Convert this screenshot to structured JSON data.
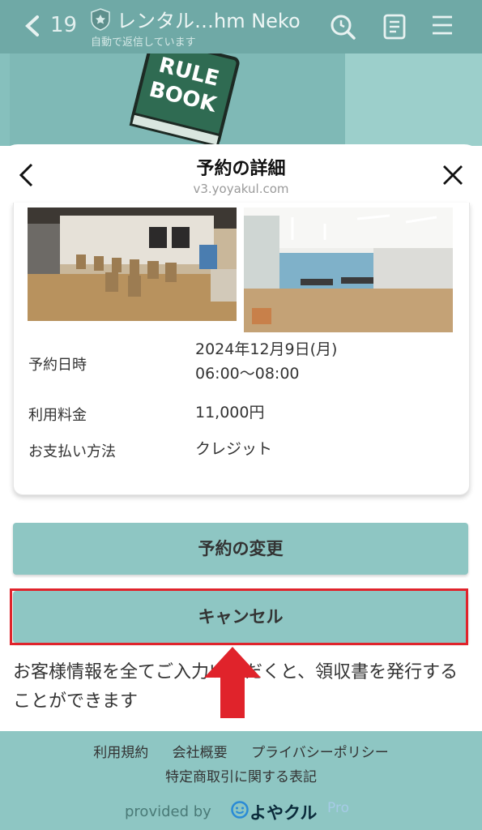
{
  "header": {
    "unread": "19",
    "title": "レンタル…hm Neko",
    "subtitle": "自動で返信しています"
  },
  "background": {
    "rulebook_text": [
      "RULE",
      "BOOK"
    ]
  },
  "sheet": {
    "title": "予約の詳細",
    "domain": "v3.yoyakul.com"
  },
  "details": [
    {
      "label": "予約日時",
      "value_lines": [
        "2024年12月9日(月)",
        "06:00〜08:00"
      ]
    },
    {
      "label": "利用料金",
      "value_lines": [
        "11,000円"
      ]
    },
    {
      "label": "お支払い方法",
      "value_lines": [
        "クレジット"
      ]
    }
  ],
  "buttons": {
    "change": "予約の変更",
    "cancel": "キャンセル"
  },
  "note": "お客様情報を全てご入力いただくと、領収書を発行することができます",
  "footer": {
    "links": [
      "利用規約",
      "会社概要",
      "プライバシーポリシー"
    ],
    "link2": "特定商取引に関する表記",
    "provided_by": "provided by",
    "brand": "よやクル",
    "brand_suffix": "Pro"
  },
  "colors": {
    "accent": "#8ec6c3",
    "header": "#6fa9a6",
    "highlight": "#e0232b"
  }
}
